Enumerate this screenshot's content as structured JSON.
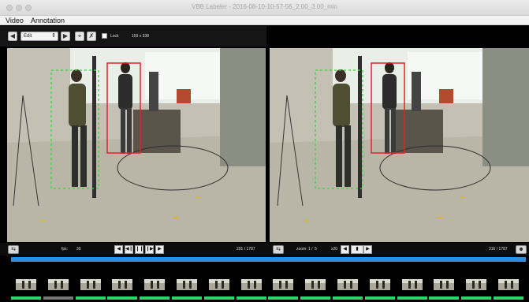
{
  "window": {
    "title": "VBB Labeler - 2016-08-10-10-57-56_2.00_3.00_min"
  },
  "menu": {
    "items": [
      "Video",
      "Annotation"
    ]
  },
  "toolbar": {
    "edit_select": "Edit",
    "lock_label": "Lock",
    "size_label": "159 x 338"
  },
  "left_controls": {
    "fps_label": "fps:",
    "fps_value": "30",
    "frame_counter": "291 / 1787"
  },
  "right_controls": {
    "zoom_label": "zoom: 1 /",
    "zoom_value": "5",
    "step_value": "x20",
    "frame_counter": "316 / 1787"
  },
  "timeline": {
    "thumbnail_count": 16
  },
  "colors": {
    "accent_blue": "#2d8de0",
    "label_green": "#2ad76a",
    "bbox_red": "#e0242a"
  }
}
